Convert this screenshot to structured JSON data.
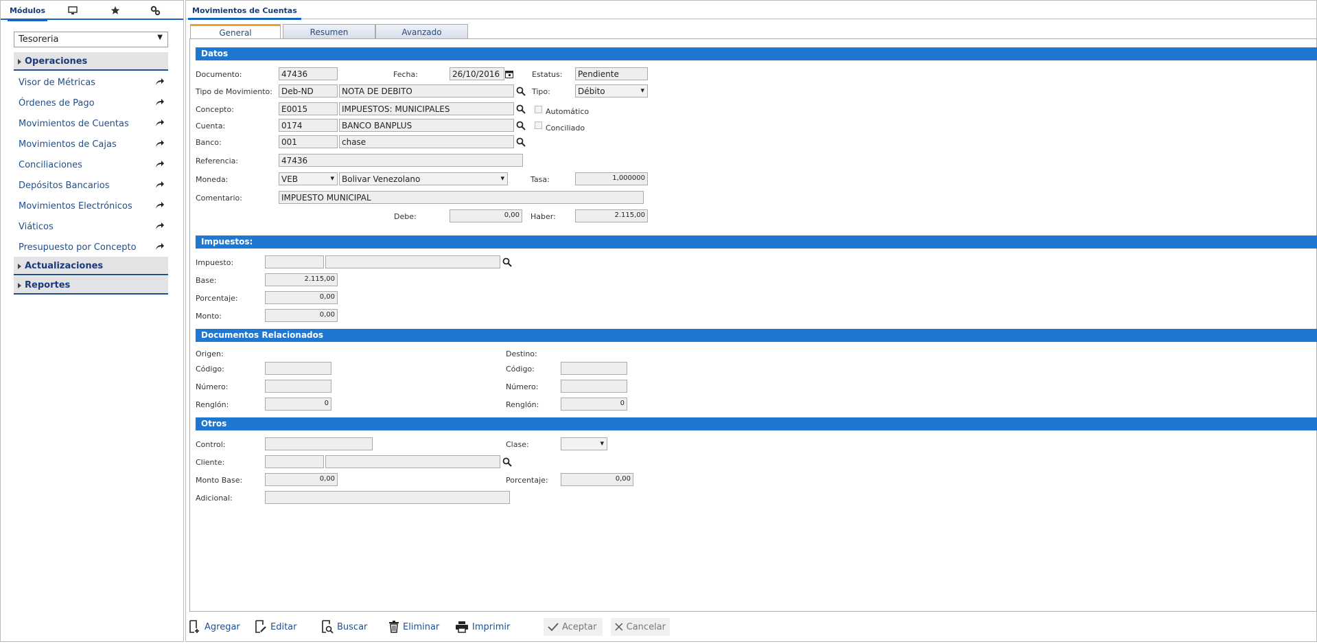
{
  "left_tabs": {
    "modulos": "Módulos"
  },
  "module_select": "Tesoreria",
  "sections": {
    "operaciones": "Operaciones",
    "actualizaciones": "Actualizaciones",
    "reportes": "Reportes"
  },
  "menu": [
    "Visor de Métricas",
    "Órdenes de Pago",
    "Movimientos de Cuentas",
    "Movimientos de Cajas",
    "Conciliaciones",
    "Depósitos Bancarios",
    "Movimientos Electrónicos",
    "Viáticos",
    "Presupuesto por Concepto"
  ],
  "window_title": "Movimientos de Cuentas",
  "tabs": [
    "General",
    "Resumen",
    "Avanzado"
  ],
  "datos": {
    "title": "Datos",
    "documento_label": "Documento:",
    "documento": "47436",
    "fecha_label": "Fecha:",
    "fecha": "26/10/2016",
    "estatus_label": "Estatus:",
    "estatus": "Pendiente",
    "tipo_mov_label": "Tipo de Movimiento:",
    "tipo_mov_code": "Deb-ND",
    "tipo_mov_desc": "NOTA DE DEBITO",
    "tipo_label": "Tipo:",
    "tipo": "Débito",
    "concepto_label": "Concepto:",
    "concepto_code": "E0015",
    "concepto_desc": "IMPUESTOS: MUNICIPALES",
    "automatico_label": "Automático",
    "cuenta_label": "Cuenta:",
    "cuenta_code": "0174",
    "cuenta_desc": "BANCO BANPLUS",
    "conciliado_label": "Conciliado",
    "banco_label": "Banco:",
    "banco_code": "001",
    "banco_desc": "chase",
    "referencia_label": "Referencia:",
    "referencia": "47436",
    "moneda_label": "Moneda:",
    "moneda_code": "VEB",
    "moneda_desc": "Bolivar Venezolano",
    "tasa_label": "Tasa:",
    "tasa": "1,000000",
    "comentario_label": "Comentario:",
    "comentario": "IMPUESTO MUNICIPAL",
    "debe_label": "Debe:",
    "debe": "0,00",
    "haber_label": "Haber:",
    "haber": "2.115,00"
  },
  "impuestos": {
    "title": "Impuestos:",
    "impuesto_label": "Impuesto:",
    "base_label": "Base:",
    "base": "2.115,00",
    "porcentaje_label": "Porcentaje:",
    "porcentaje": "0,00",
    "monto_label": "Monto:",
    "monto": "0,00"
  },
  "docs": {
    "title": "Documentos Relacionados",
    "origen_label": "Origen:",
    "destino_label": "Destino:",
    "codigo_label": "Código:",
    "numero_label": "Número:",
    "renglon_label": "Renglón:",
    "renglon_origen": "0",
    "renglon_destino": "0"
  },
  "otros": {
    "title": "Otros",
    "control_label": "Control:",
    "clase_label": "Clase:",
    "cliente_label": "Cliente:",
    "monto_base_label": "Monto Base:",
    "monto_base": "0,00",
    "porcentaje_label": "Porcentaje:",
    "porcentaje": "0,00",
    "adicional_label": "Adicional:"
  },
  "footer": {
    "agregar": "Agregar",
    "editar": "Editar",
    "buscar": "Buscar",
    "eliminar": "Eliminar",
    "imprimir": "Imprimir",
    "aceptar": "Aceptar",
    "cancelar": "Cancelar"
  }
}
